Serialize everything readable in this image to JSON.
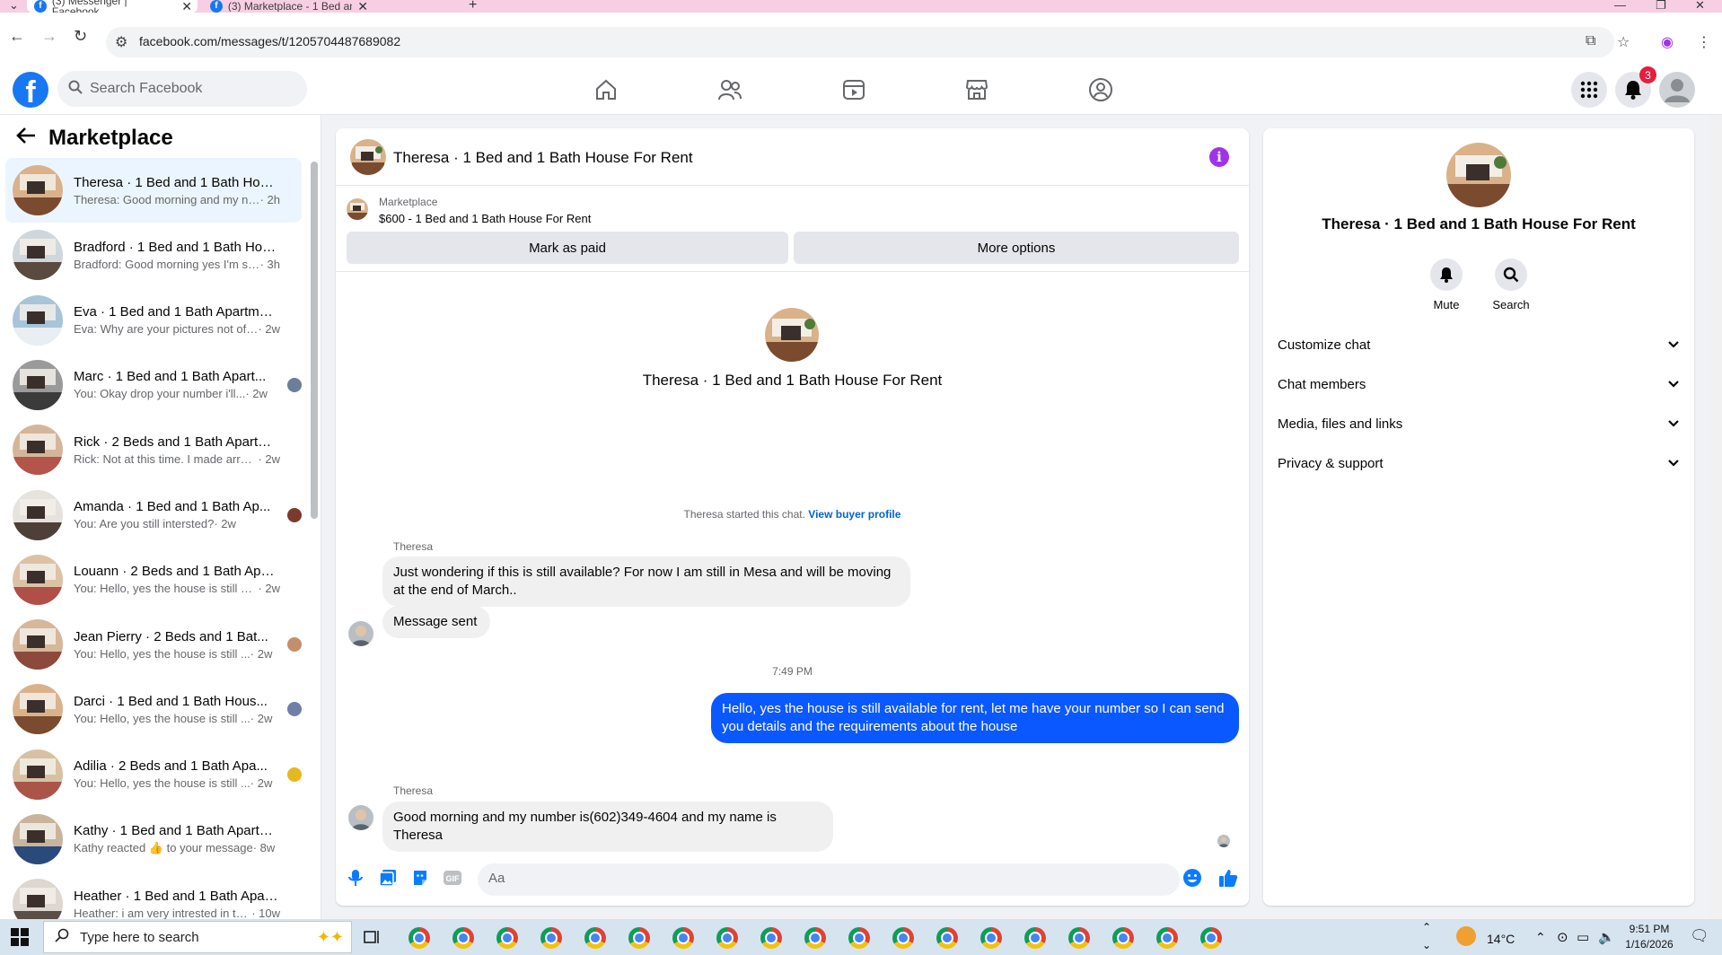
{
  "browser": {
    "tabs": [
      {
        "title": "(3) Messenger | Facebook"
      },
      {
        "title": "(3) Marketplace - 1 Bed and 1 B"
      }
    ],
    "url": "facebook.com/messages/t/1205704487689082"
  },
  "fb": {
    "search_placeholder": "Search Facebook",
    "notification_count": "3"
  },
  "sidebar": {
    "title": "Marketplace",
    "conversations": [
      {
        "name": "Theresa · 1 Bed and 1 Bath Hous...",
        "snippet": "Theresa: Good morning and my nu...",
        "time": " · 2h",
        "active": true
      },
      {
        "name": "Bradford · 1 Bed and 1 Bath Hou...",
        "snippet": "Bradford: Good morning yes I'm sti...",
        "time": " · 3h"
      },
      {
        "name": "Eva · 1 Bed and 1 Bath Apartmen...",
        "snippet": "Eva: Why are your pictures not of t...",
        "time": " · 2w"
      },
      {
        "name": "Marc · 1 Bed and 1 Bath Apart...",
        "snippet": "You: Okay drop your number i'll...",
        "time": " · 2w"
      },
      {
        "name": "Rick · 2 Beds and 1 Bath Apartm...",
        "snippet": "Rick: Not at this time. I made arran...",
        "time": " · 2w"
      },
      {
        "name": "Amanda · 1 Bed and 1 Bath Ap...",
        "snippet": "You: Are you still intersted?",
        "time": " · 2w"
      },
      {
        "name": "Louann · 2 Beds and 1 Bath Apar...",
        "snippet": "You: Hello, yes the house is still ava...",
        "time": " · 2w"
      },
      {
        "name": "Jean Pierry · 2 Beds and 1 Bat...",
        "snippet": "You: Hello, yes the house is still ...",
        "time": " · 2w"
      },
      {
        "name": "Darci · 1 Bed and 1 Bath Hous...",
        "snippet": "You: Hello, yes the house is still ...",
        "time": " · 2w"
      },
      {
        "name": "Adilia · 2 Beds and 1 Bath Apa...",
        "snippet": "You: Hello, yes the house is still ...",
        "time": " · 2w"
      },
      {
        "name": "Kathy · 1 Bed and 1 Bath Apartm...",
        "snippet": "Kathy reacted 👍 to your message",
        "time": " · 8w"
      },
      {
        "name": "Heather · 1 Bed and 1 Bath Apart...",
        "snippet": "Heather: i am very intrested in thi...",
        "time": " · 10w"
      }
    ]
  },
  "chat": {
    "title": "Theresa · 1 Bed and 1 Bath House For Rent",
    "marketplace_label": "Marketplace",
    "listing": "$600 - 1 Bed and 1 Bath House For Rent",
    "mark_paid": "Mark as paid",
    "more_options": "More options",
    "intro_name": "Theresa · 1 Bed and 1 Bath House For Rent",
    "started_text": "Theresa started this chat.",
    "view_profile": "View buyer profile",
    "messages": [
      {
        "sender": "Theresa",
        "text": "Just wondering if this is still available? For now I am still in Mesa and will be moving at the end of March.."
      },
      {
        "text": "Message sent"
      },
      {
        "timestamp": "7:49 PM"
      },
      {
        "text": "Hello, yes the house is still available for rent, let me have your number so I can send you details and the requirements about the house"
      },
      {
        "sender": "Theresa",
        "text": "Good morning and my number is(602)349-4604 and my name is Theresa"
      }
    ],
    "composer_placeholder": "Aa"
  },
  "right_panel": {
    "name": "Theresa · 1 Bed and 1 Bath House For Rent",
    "mute_label": "Mute",
    "search_label": "Search",
    "sections": [
      "Customize chat",
      "Chat members",
      "Media, files and links",
      "Privacy & support"
    ]
  },
  "taskbar": {
    "search_placeholder": "Type here to search",
    "temperature": "14°C",
    "time": "9:51 PM",
    "date": "1/16/2026"
  },
  "colors": {
    "fb_blue": "#1877f2",
    "outgoing_bubble": "#0a58ff",
    "active_conversation": "#ebf5ff",
    "info_icon": "#a033e8"
  }
}
